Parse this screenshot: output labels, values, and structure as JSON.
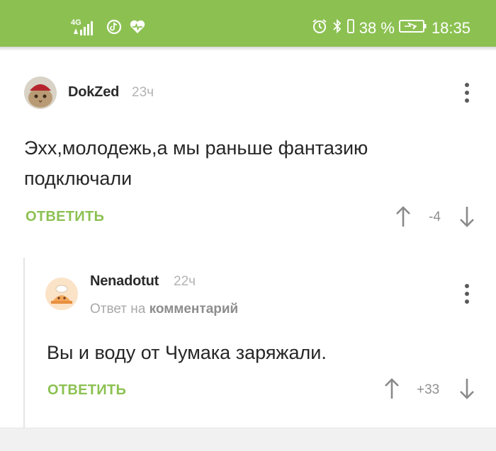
{
  "status_bar": {
    "network_label": "4G",
    "battery_percent": "38 %",
    "time": "18:35"
  },
  "comments": [
    {
      "author": "DokZed",
      "time": "23ч",
      "text_line1": "Эхх,молодежь,а мы раньше фантазию",
      "text_line2": "подключали",
      "reply_label": "ОТВЕТИТЬ",
      "score": "-4"
    },
    {
      "author": "Nenadotut",
      "time": "22ч",
      "reply_prefix": "Ответ на",
      "reply_target": "комментарий",
      "text_line1": "Вы и воду от Чумака заряжали.",
      "reply_label": "ОТВЕТИТЬ",
      "score": "+33"
    }
  ],
  "colors": {
    "accent": "#8cc152",
    "text": "#262626",
    "muted": "#b3b3b3"
  },
  "icons": [
    "signal-icon",
    "tiktok-icon",
    "heart-monitor-icon",
    "alarm-icon",
    "bluetooth-icon",
    "vibrate-icon",
    "battery-icon",
    "arrow-up-icon",
    "arrow-down-icon",
    "more-vertical-icon"
  ]
}
